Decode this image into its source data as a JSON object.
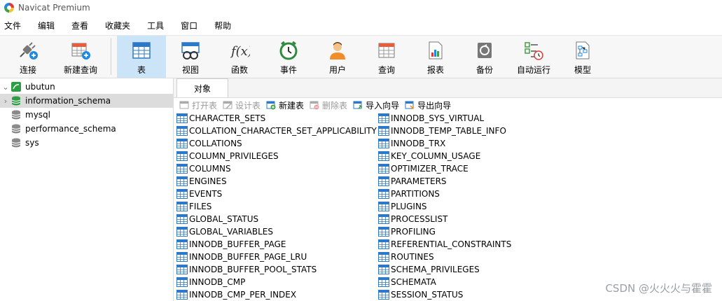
{
  "app": {
    "title": "Navicat Premium"
  },
  "menu": [
    "文件",
    "编辑",
    "查看",
    "收藏夹",
    "工具",
    "窗口",
    "帮助"
  ],
  "toolbar": {
    "connect": "连接",
    "new_query": "新建查询",
    "buttons": [
      "表",
      "视图",
      "函数",
      "事件",
      "用户",
      "查询",
      "报表",
      "备份",
      "自动运行",
      "模型"
    ],
    "active": "表"
  },
  "tree": {
    "connection": "ubutun",
    "databases": [
      "information_schema",
      "mysql",
      "performance_schema",
      "sys"
    ],
    "selected": "information_schema"
  },
  "tabs": {
    "objects": "对象"
  },
  "actions": {
    "open": "打开表",
    "design": "设计表",
    "new": "新建表",
    "delete": "删除表",
    "import": "导入向导",
    "export": "导出向导"
  },
  "objects": {
    "col1": [
      "CHARACTER_SETS",
      "COLLATION_CHARACTER_SET_APPLICABILITY",
      "COLLATIONS",
      "COLUMN_PRIVILEGES",
      "COLUMNS",
      "ENGINES",
      "EVENTS",
      "FILES",
      "GLOBAL_STATUS",
      "GLOBAL_VARIABLES",
      "INNODB_BUFFER_PAGE",
      "INNODB_BUFFER_PAGE_LRU",
      "INNODB_BUFFER_POOL_STATS",
      "INNODB_CMP",
      "INNODB_CMP_PER_INDEX"
    ],
    "col2": [
      "INNODB_SYS_VIRTUAL",
      "INNODB_TEMP_TABLE_INFO",
      "INNODB_TRX",
      "KEY_COLUMN_USAGE",
      "OPTIMIZER_TRACE",
      "PARAMETERS",
      "PARTITIONS",
      "PLUGINS",
      "PROCESSLIST",
      "PROFILING",
      "REFERENTIAL_CONSTRAINTS",
      "ROUTINES",
      "SCHEMA_PRIVILEGES",
      "SCHEMATA",
      "SESSION_STATUS"
    ]
  },
  "watermark": "CSDN @火火火与霍霍"
}
